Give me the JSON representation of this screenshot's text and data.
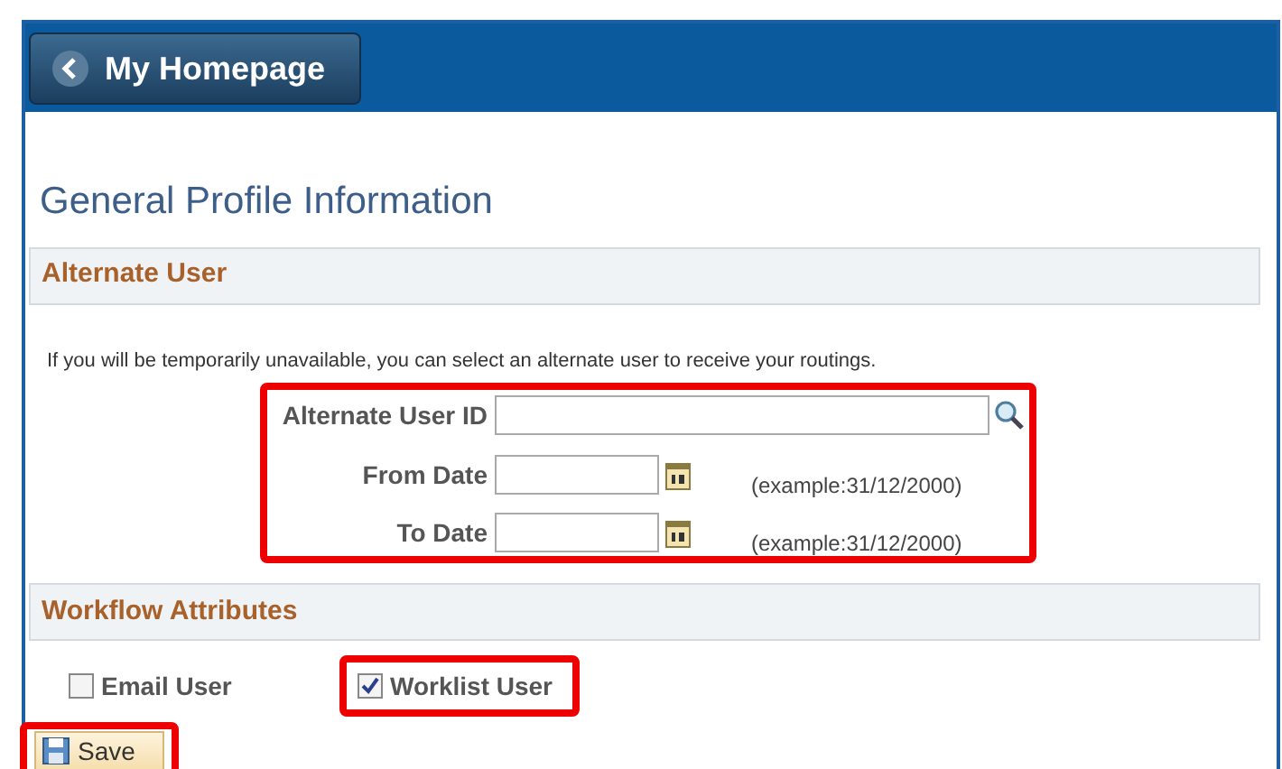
{
  "header": {
    "back_button": "My Homepage"
  },
  "title": "General Profile Information",
  "alternate_user": {
    "heading": "Alternate User",
    "instruction": "If you will be temporarily unavailable, you can select an alternate user to receive your routings.",
    "highlighted": true,
    "fields": [
      {
        "kind": "lookup",
        "label": "Alternate User ID"
      },
      {
        "kind": "date",
        "label": "From Date",
        "hint": "(example:31/12/2000)"
      },
      {
        "kind": "date",
        "label": "To Date",
        "hint": "(example:31/12/2000)"
      }
    ]
  },
  "workflow": {
    "heading": "Workflow Attributes",
    "options": [
      {
        "label": "Email User",
        "checked": false,
        "highlighted": false
      },
      {
        "label": "Worklist User",
        "checked": true,
        "highlighted": true
      }
    ]
  },
  "save_button": {
    "label": "Save",
    "highlighted": true
  }
}
